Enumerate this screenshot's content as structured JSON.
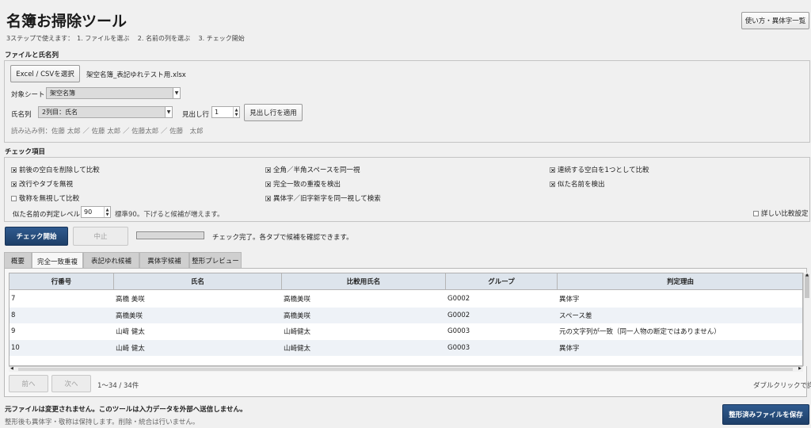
{
  "app": {
    "title": "名簿お掃除ツール",
    "steps": "3ステップで使えます：　1. ファイルを選ぶ　 2. 名前の列を選ぶ　 3. チェック開始",
    "help_button": "使い方・異体字一覧"
  },
  "file_section": {
    "heading": "ファイルと氏名列",
    "select_button": "Excel / CSVを選択",
    "file_name": "架空名簿_表記ゆれテスト用.xlsx",
    "sheet_label": "対象シート",
    "sheet_value": "架空名簿",
    "name_col_label": "氏名列",
    "name_col_value": "2列目：氏名",
    "header_row_label": "見出し行",
    "header_row_value": "1",
    "apply_button": "見出し行を適用",
    "preview": "読み込み例：佐藤 太郎 ／ 佐藤 太郎 ／ 佐藤太郎 ／ 佐藤　太郎"
  },
  "check_section": {
    "heading": "チェック項目",
    "items": [
      {
        "label": "前後の空白を削除して比較",
        "checked": true
      },
      {
        "label": "全角／半角スペースを同一視",
        "checked": true
      },
      {
        "label": "連続する空白を1つとして比較",
        "checked": true
      },
      {
        "label": "改行やタブを無視",
        "checked": true
      },
      {
        "label": "完全一致の重複を検出",
        "checked": true
      },
      {
        "label": "似た名前を検出",
        "checked": true
      },
      {
        "label": "敬称を無視して比較",
        "checked": false
      },
      {
        "label": "異体字／旧字新字を同一視して検索",
        "checked": true
      }
    ],
    "level_label": "似た名前の判定レベル",
    "level_value": "90",
    "level_hint": "標準90。下げると候補が増えます。",
    "detail_label": "詳しい比較設定",
    "detail_checked": false
  },
  "actions": {
    "start_button": "チェック開始",
    "stop_button": "中止",
    "status": "チェック完了。各タブで候補を確認できます。",
    "progress": 1.0
  },
  "tabs": [
    "概要",
    "完全一致重複",
    "表記ゆれ候補",
    "異体字候補",
    "整形プレビュー"
  ],
  "active_tab": 1,
  "table": {
    "columns": [
      "行番号",
      "氏名",
      "比較用氏名",
      "グループ",
      "判定理由"
    ],
    "rows": [
      [
        "7",
        "高橋 美咲",
        "高橋美咲",
        "G0002",
        "異体字"
      ],
      [
        "8",
        "高橋美咲",
        "高橋美咲",
        "G0002",
        "スペース差"
      ],
      [
        "9",
        "山﨑 健太",
        "山崎健太",
        "G0003",
        "元の文字列が一致（同一人物の断定ではありません）"
      ],
      [
        "10",
        "山崎 健太",
        "山崎健太",
        "G0003",
        "異体字"
      ]
    ]
  },
  "pager": {
    "prev": "前へ",
    "next": "次へ",
    "info": "1〜34 / 34件",
    "hint": "ダブルクリックで詳細"
  },
  "footer": {
    "note_bold": "元ファイルは変更されません。このツールは入力データを外部へ送信しません。",
    "note": "整形後も異体字・敬称は保持します。削除・統合は行いません。",
    "save_button": "整形済みファイルを保存"
  },
  "colors": {
    "primary": "#1e3f68",
    "header_bg": "#dde4ec",
    "alt_row": "#eef2f7"
  }
}
